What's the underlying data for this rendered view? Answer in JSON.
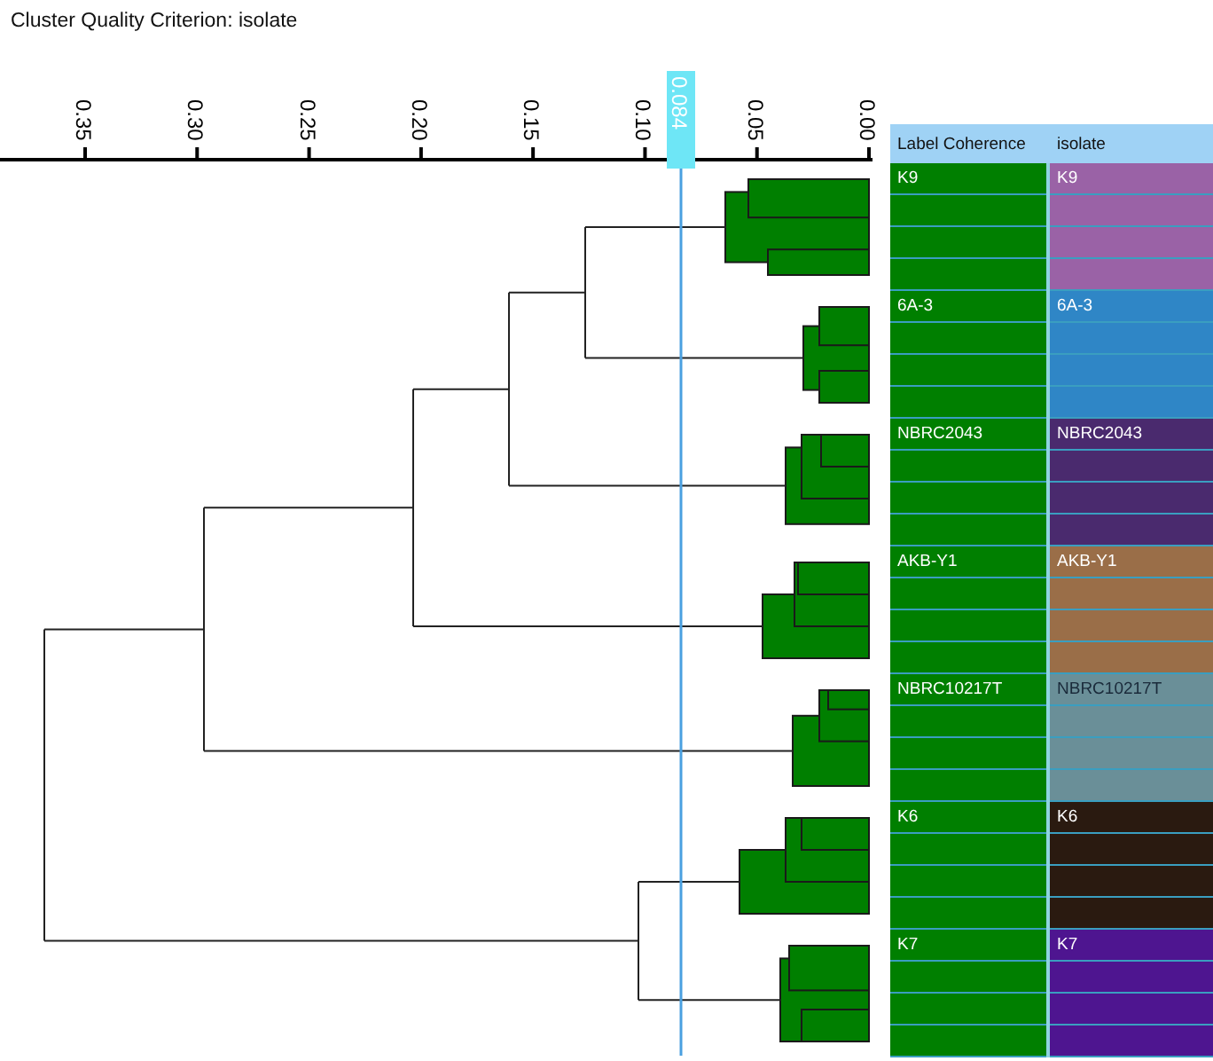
{
  "title": "Cluster Quality Criterion: isolate",
  "axis": {
    "ticks": [
      "0.35",
      "0.30",
      "0.25",
      "0.20",
      "0.15",
      "0.10",
      "0.05",
      "0.00"
    ]
  },
  "cut_marker": {
    "label": "0.084"
  },
  "table": {
    "columns": [
      "Label Coherence",
      "isolate"
    ],
    "groups": [
      {
        "label_coherence": "K9",
        "isolate": "K9",
        "color": "#9a62a6"
      },
      {
        "label_coherence": "6A-3",
        "isolate": "6A-3",
        "color": "#2f86c6"
      },
      {
        "label_coherence": "NBRC2043",
        "isolate": "NBRC2043",
        "color": "#4a2a6e"
      },
      {
        "label_coherence": "AKB-Y1",
        "isolate": "AKB-Y1",
        "color": "#9a6e48"
      },
      {
        "label_coherence": "NBRC10217T",
        "isolate": "NBRC10217T",
        "color": "#6a8f98"
      },
      {
        "label_coherence": "K6",
        "isolate": "K6",
        "color": "#2a1a10"
      },
      {
        "label_coherence": "K7",
        "isolate": "K7",
        "color": "#4e1590"
      }
    ]
  }
}
